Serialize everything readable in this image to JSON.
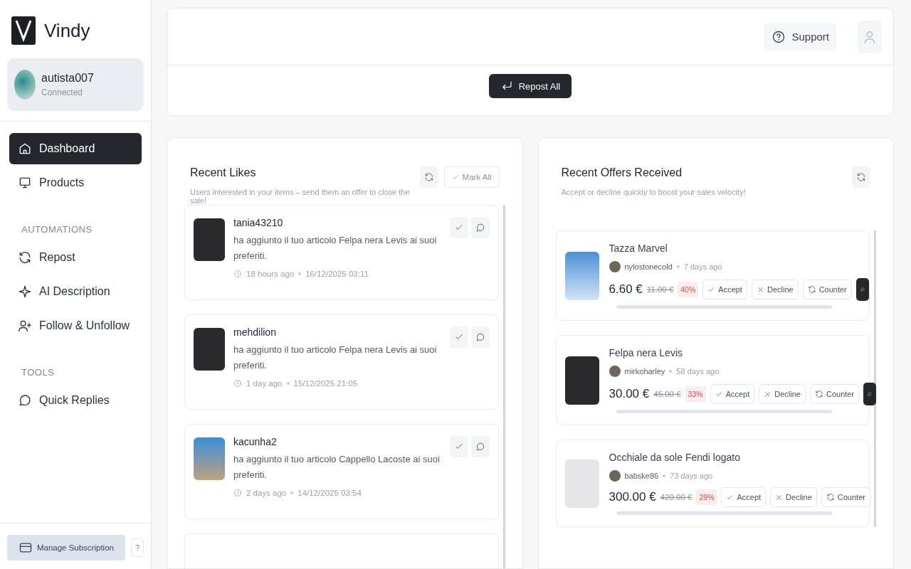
{
  "brand": {
    "name": "Vindy"
  },
  "account": {
    "username": "autista007",
    "status": "Connected"
  },
  "sidebar": {
    "items": [
      {
        "label": "Dashboard",
        "selected": true
      },
      {
        "label": "Products",
        "selected": false
      }
    ],
    "sections": [
      {
        "title": "AUTOMATIONS",
        "items": [
          {
            "label": "Repost",
            "selected": false
          },
          {
            "label": "AI Description",
            "selected": false
          },
          {
            "label": "Follow & Unfollow",
            "selected": false
          }
        ]
      },
      {
        "title": "TOOLS",
        "items": [
          {
            "label": "Quick Replies",
            "selected": false
          }
        ]
      }
    ],
    "footer": {
      "manage": "Manage Subscription",
      "help": "?"
    }
  },
  "header": {
    "support": "Support"
  },
  "repost_all": "Repost All",
  "likes": {
    "title": "Recent Likes",
    "subtitle": "Users interested in your items – send them an offer to close the sale!",
    "mark_all": "Mark All",
    "items": [
      {
        "user": "tania43210",
        "text": "ha aggiunto il tuo articolo Felpa nera Levis ai suoi preferiti.",
        "ago": "18 hours ago",
        "date": "16/12/2025 03:11"
      },
      {
        "user": "mehdilion",
        "text": "ha aggiunto il tuo articolo Felpa nera Levis ai suoi preferiti.",
        "ago": "1 day ago",
        "date": "15/12/2025 21:05"
      },
      {
        "user": "kacunha2",
        "text": "ha aggiunto il tuo articolo Cappello Lacoste ai suoi preferiti.",
        "ago": "2 days ago",
        "date": "14/12/2025 03:54"
      }
    ]
  },
  "offers": {
    "title": "Recent Offers Received",
    "subtitle": "Accept or decline quickly to boost your sales velocity!",
    "items": [
      {
        "item": "Tazza Marvel",
        "user": "nylostonecold",
        "ago": "7 days ago",
        "price": "6.60 €",
        "original": "11.00 €",
        "discount": "40%",
        "accept": "Accept",
        "decline": "Decline",
        "counter": "Counter",
        "message_button": true
      },
      {
        "item": "Felpa nera Levis",
        "user": "mirkoharley",
        "ago": "58 days ago",
        "price": "30.00 €",
        "original": "45.00 €",
        "discount": "33%",
        "accept": "Accept",
        "decline": "Decline",
        "counter": "Counter",
        "message_button": true
      },
      {
        "item": "Occhiale da sole Fendi logato",
        "user": "babske86",
        "ago": "73 days ago",
        "price": "300.00 €",
        "original": "420.00 €",
        "discount": "29%",
        "accept": "Accept",
        "decline": "Decline",
        "counter": "Counter",
        "message_button": false
      }
    ]
  }
}
